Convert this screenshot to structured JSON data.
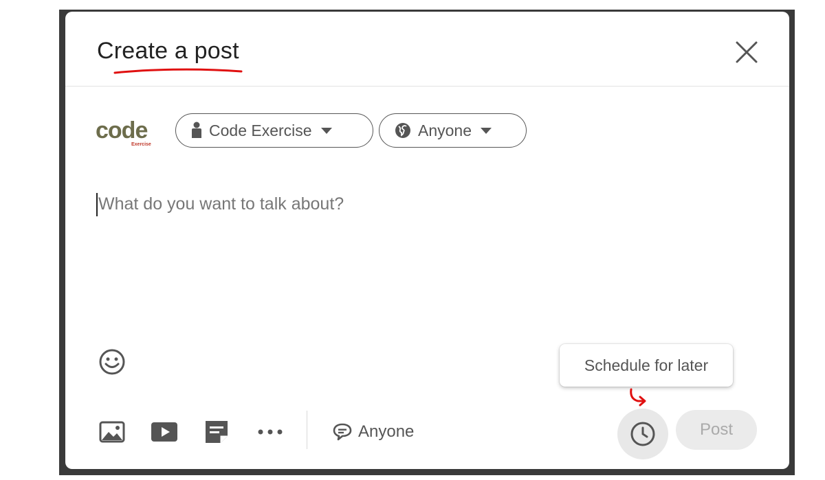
{
  "modal": {
    "title": "Create a post",
    "close_icon": "close-icon"
  },
  "author": {
    "logo_text": "code",
    "logo_subtext": "Exercise",
    "identity_label": "Code Exercise",
    "identity_icon": "person-icon",
    "audience_label": "Anyone",
    "audience_icon": "globe-icon"
  },
  "editor": {
    "placeholder": "What do you want to talk about?",
    "emoji_icon": "smiley-icon"
  },
  "tooltip": {
    "text": "Schedule for later"
  },
  "toolbar": {
    "icons": [
      "photo-icon",
      "video-icon",
      "document-icon",
      "more-icon"
    ],
    "comment_control_label": "Anyone",
    "comment_icon": "comment-icon",
    "schedule_icon": "clock-icon",
    "post_label": "Post"
  },
  "colors": {
    "annotation_red": "#e01010",
    "post_disabled_bg": "#ebebeb",
    "post_disabled_text": "#aaaaaa",
    "backdrop": "#3a3a3a"
  }
}
